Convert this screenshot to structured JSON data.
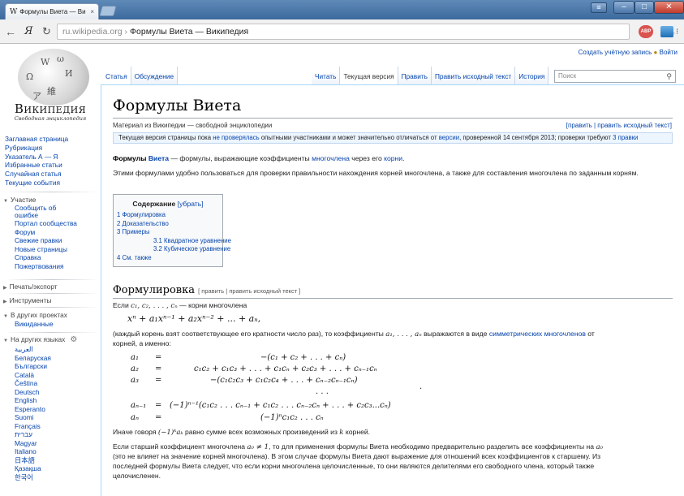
{
  "browser": {
    "tab_title": "Формулы Виета — Ви",
    "tab_close": "×",
    "tab_logo": "W",
    "back": "←",
    "yandex": "Я",
    "reload": "↻",
    "url_domain": "ru.wikipedia.org",
    "url_sep": "›",
    "url_title": "Формулы Виета — Википедия",
    "star": "☆",
    "abp": "ABP",
    "win_min": "–",
    "win_max": "□",
    "win_close": "✕",
    "win_menu": "≡"
  },
  "personal": {
    "create": "Создать учётную запись",
    "login": "Войти"
  },
  "logo": {
    "wordmark": "Википедия",
    "tagline": "Свободная энциклопедия",
    "glyphs": [
      "W",
      "Ω",
      "И",
      "維",
      "ω",
      "ア"
    ]
  },
  "sidebar": {
    "main": [
      "Заглавная страница",
      "Рубрикация",
      "Указатель А — Я",
      "Избранные статьи",
      "Случайная статья",
      "Текущие события"
    ],
    "participation_title": "Участие",
    "participation": [
      "Сообщить об",
      "ошибке",
      "Портал сообщества",
      "Форум",
      "Свежие правки",
      "Новые страницы",
      "Справка",
      "Пожертвования"
    ],
    "print_title": "Печать/экспорт",
    "tools_title": "Инструменты",
    "projects_title": "В других проектах",
    "projects": [
      "Викиданные"
    ],
    "langs_title": "На других языках",
    "langs": [
      "العربية",
      "Беларуская",
      "Български",
      "Català",
      "Čeština",
      "Deutsch",
      "English",
      "Esperanto",
      "Suomi",
      "Français",
      "עברית",
      "Magyar",
      "Italiano",
      "日本語",
      "Қазақша",
      "한국어"
    ]
  },
  "tabs": {
    "left": [
      "Статья",
      "Обсуждение"
    ],
    "right": [
      "Читать",
      "Текущая версия",
      "Править",
      "Править исходный текст",
      "История"
    ],
    "search_placeholder": "Поиск"
  },
  "article": {
    "title": "Формулы Виета",
    "sitesub": "Материал из Википедии — свободной энциклопедии",
    "edit_links": "[править | править исходный текст]",
    "flagged_pre": "Текущая версия страницы пока ",
    "flagged_link": "не проверялась",
    "flagged_mid": " опытными участниками и может значительно отличаться от ",
    "flagged_link2": "версии",
    "flagged_post": ", проверенной 14 сентября 2013; проверки требуют ",
    "flagged_link3": "3 правки",
    "intro_b1": "Формулы ",
    "intro_b2": "Виета",
    "intro_1": " — формулы, выражающие коэффициенты ",
    "intro_l1": "многочлена",
    "intro_2": " через его ",
    "intro_l2": "корни",
    "intro_3": ".",
    "para2": "Этими формулами удобно пользоваться для проверки правильности нахождения корней многочлена, а также для составления многочлена по заданным корням.",
    "toc_title": "Содержание",
    "toc_hide": "[убрать]",
    "toc": [
      {
        "text": "1 Формулировка",
        "level": 1
      },
      {
        "text": "2 Доказательство",
        "level": 1
      },
      {
        "text": "3 Примеры",
        "level": 1
      },
      {
        "text": "3.1 Квадратное уравнение",
        "level": 2
      },
      {
        "text": "3.2 Кубическое уравнение",
        "level": 2
      },
      {
        "text": "4 См. также",
        "level": 1
      }
    ],
    "h2": "Формулировка",
    "h2_edit": "[ править | править исходный текст ]",
    "f_intro_pre": "Если ",
    "f_intro_math": "c₁, c₂, . . . , cₙ",
    "f_intro_post": " — корни многочлена",
    "poly": "xⁿ + a₁xⁿ⁻¹ + a₂xⁿ⁻² + ... + aₙ,",
    "f2_pre": "(каждый корень взят соответствующее его кратности число раз), то коэффициенты ",
    "f2_math": "a₁, . . . , aₙ",
    "f2_mid": " выражаются в виде ",
    "f2_link": "симметрических многочленов",
    "f2_post": " от",
    "f3": "корней, а именно:",
    "system_lhs": [
      "a₁",
      "a₂",
      "a₃",
      "",
      "aₙ₋₁",
      "aₙ"
    ],
    "system_eq": [
      "=",
      "=",
      "=",
      "",
      "=",
      "="
    ],
    "system_rhs": [
      "−(c₁ + c₂ + . . . + cₙ)",
      "c₁c₂ + c₁c₃ + . . . + c₁cₙ + c₂c₃ + . . . + cₙ₋₁cₙ",
      "−(c₁c₂c₃ + c₁c₂c₄ + . . . + cₙ₋₂cₙ₋₁cₙ)",
      ". . .",
      "(−1)ⁿ⁻¹(c₁c₂ . . . cₙ₋₁ + c₁c₂ . . . cₙ₋₂cₙ + . . . + c₂c₃...cₙ)",
      "(−1)ⁿc₁c₂ . . . cₙ"
    ],
    "dot": ".",
    "other_pre": "Иначе говоря ",
    "other_math": "(−1)ᵏaₖ",
    "other_mid": " равно сумме всех возможных произведений из ",
    "other_k": "k",
    "other_post": " корней.",
    "last_pre": "Если старший коэффициент многочлена ",
    "last_math": "a₀ ≠ 1",
    "last_mid": ", то для применения формулы Виета необходимо предварительно разделить все коэффициенты на ",
    "last_a0": "a₀",
    "last_2": "(это не влияет на значение корней многочлена). В этом случае формулы Виета дают выражение для отношений всех коэффициентов к старшему. Из",
    "last_3": "последней формулы Виета следует, что если корни многочлена целочисленные, то они являются делителями его свободного члена, который также",
    "last_4": "целочисленен."
  }
}
